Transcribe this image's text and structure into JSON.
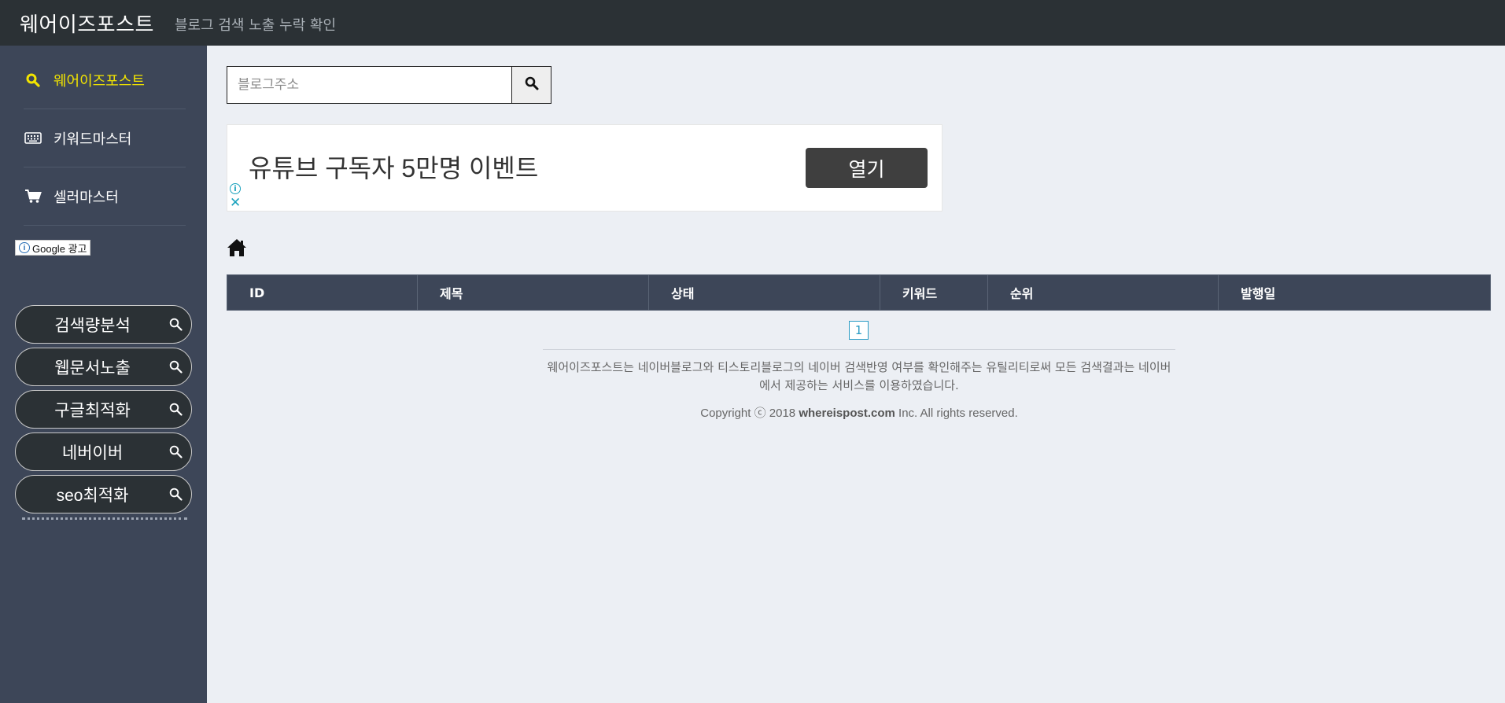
{
  "header": {
    "brand": "웨어이즈포스트",
    "tagline": "블로그 검색 노출 누락 확인"
  },
  "sidebar": {
    "items": [
      {
        "label": "웨어이즈포스트",
        "icon": "search-icon",
        "active": true
      },
      {
        "label": "키워드마스터",
        "icon": "keyboard-icon",
        "active": false
      },
      {
        "label": "셀러마스터",
        "icon": "cart-icon",
        "active": false
      }
    ],
    "ad_tag": "Google 광고",
    "ad_links": [
      {
        "label": "검색량분석",
        "icon": "search-icon"
      },
      {
        "label": "웹문서노출",
        "icon": "search-icon"
      },
      {
        "label": "구글최적화",
        "icon": "search-icon"
      },
      {
        "label": "네버이버",
        "icon": "search-icon"
      },
      {
        "label": "seo최적화",
        "icon": "search-icon"
      }
    ]
  },
  "search": {
    "placeholder": "블로그주소",
    "value": ""
  },
  "ad_banner": {
    "text": "유튜브 구독자 5만명 이벤트",
    "button": "열기"
  },
  "table": {
    "columns": [
      "ID",
      "제목",
      "상태",
      "키워드",
      "순위",
      "발행일"
    ],
    "rows": []
  },
  "pagination": {
    "current": "1"
  },
  "footer": {
    "description": "웨어이즈포스트는 네이버블로그와 티스토리블로그의 네이버 검색반영 여부를 확인해주는 유틸리티로써 모든 검색결과는 네이버에서 제공하는 서비스를 이용하였습니다.",
    "copyright_prefix": "Copyright ⓒ 2018 ",
    "copyright_domain": "whereispost.com",
    "copyright_suffix": " Inc. All rights reserved."
  },
  "colors": {
    "topbar": "#2b3135",
    "sidebar": "#3d4658",
    "active": "#f2e400",
    "page_bg": "#eceff4",
    "accent": "#2a9bc4"
  }
}
